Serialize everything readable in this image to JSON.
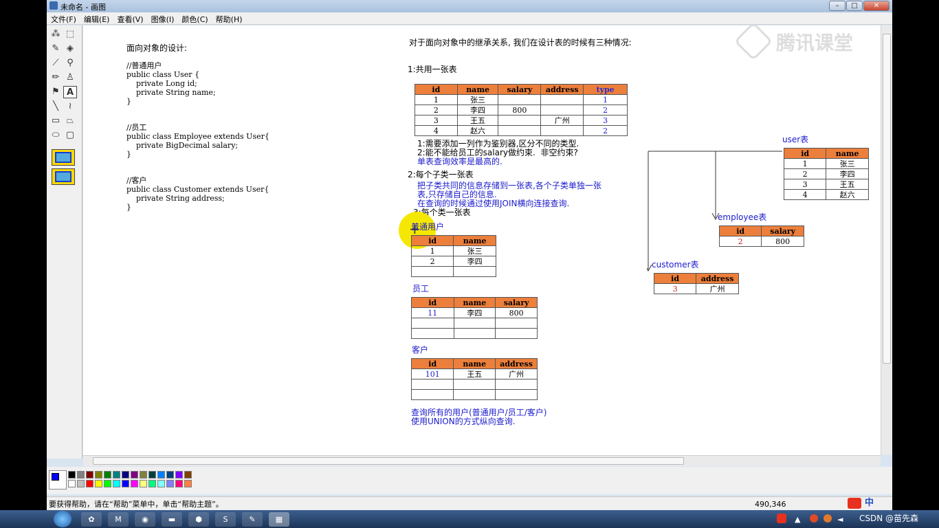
{
  "window": {
    "title": "未命名 - 画图"
  },
  "menu": [
    "文件(F)",
    "编辑(E)",
    "查看(V)",
    "图像(I)",
    "颜色(C)",
    "帮助(H)"
  ],
  "watermark": "腾讯课堂",
  "left_code": {
    "heading": "面向对象的设计:",
    "lines": [
      "//普通用户",
      "public class User {",
      "    private Long id;",
      "    private String name;",
      "}",
      "//员工",
      "public class Employee extends User{",
      "    private BigDecimal salary;",
      "}",
      "//客户",
      "public class Customer extends User{",
      "    private String address;",
      "}"
    ]
  },
  "right": {
    "heading": "对于面向对象中的继承关系, 我们在设计表的时候有三种情况:",
    "case1": "1:共用一张表",
    "notes1": [
      "1:需要添加一列作为鉴别器,区分不同的类型.",
      "2:能不能给员工的salary做约束.  非空约束?"
    ],
    "notes1b": "单表查询效率是最高的.",
    "case2": "2:每个子类一张表",
    "case2_desc": [
      "把子类共同的信息存储到一张表,各个子类单独一张",
      "表,只存储自己的信息.",
      "在查询的时候通过使用JOIN横向连接查询."
    ],
    "case3": "3:每个类一张表",
    "label_user": "普通用户",
    "label_emp": "员工",
    "label_cust": "客户",
    "union_note": [
      "查询所有的用户(普通用户/员工/客户)",
      "使用UNION的方式纵向查询."
    ]
  },
  "table1": {
    "headers": [
      "id",
      "name",
      "salary",
      "address",
      "type"
    ],
    "rows": [
      [
        "1",
        "张三",
        "",
        "",
        "1"
      ],
      [
        "2",
        "李四",
        "800",
        "",
        "2"
      ],
      [
        "3",
        "王五",
        "",
        "广州",
        "3"
      ],
      [
        "4",
        "赵六",
        "",
        "",
        "2"
      ]
    ]
  },
  "table_user": {
    "headers": [
      "id",
      "name"
    ],
    "rows": [
      [
        "1",
        "张三"
      ],
      [
        "2",
        "李四"
      ],
      [
        "",
        ""
      ]
    ]
  },
  "table_emp": {
    "headers": [
      "id",
      "name",
      "salary"
    ],
    "rows": [
      [
        "11",
        "李四",
        "800"
      ],
      [
        "",
        "",
        ""
      ],
      [
        "",
        "",
        ""
      ]
    ]
  },
  "table_cust": {
    "headers": [
      "id",
      "name",
      "address"
    ],
    "rows": [
      [
        "101",
        "王五",
        "广州"
      ],
      [
        "",
        "",
        ""
      ],
      [
        "",
        "",
        ""
      ]
    ]
  },
  "diagram": {
    "user_label": "user表",
    "emp_label": "employee表",
    "cust_label": "customer表",
    "user": {
      "headers": [
        "id",
        "name"
      ],
      "rows": [
        [
          "1",
          "张三"
        ],
        [
          "2",
          "李四"
        ],
        [
          "3",
          "王五"
        ],
        [
          "4",
          "赵六"
        ]
      ]
    },
    "emp": {
      "headers": [
        "id",
        "salary"
      ],
      "rows": [
        [
          "2",
          "800"
        ]
      ]
    },
    "cust": {
      "headers": [
        "id",
        "address"
      ],
      "rows": [
        [
          "3",
          "广州"
        ]
      ]
    }
  },
  "status": {
    "help": "要获得帮助，请在“帮助”菜单中，单击“帮助主题”。",
    "coords": "490,346"
  },
  "tray": {
    "lang": "中",
    "credit": "CSDN @苗先森"
  },
  "colors": {
    "palette_top": [
      "#000000",
      "#808080",
      "#800000",
      "#808000",
      "#008000",
      "#008080",
      "#000080",
      "#800080",
      "#808040",
      "#004040",
      "#0080ff",
      "#004080",
      "#8000ff",
      "#804000"
    ],
    "palette_bottom": [
      "#ffffff",
      "#c0c0c0",
      "#ff0000",
      "#ffff00",
      "#00ff00",
      "#00ffff",
      "#0000ff",
      "#ff00ff",
      "#ffff80",
      "#00ff80",
      "#80ffff",
      "#8080ff",
      "#ff0080",
      "#ff8040"
    ]
  }
}
